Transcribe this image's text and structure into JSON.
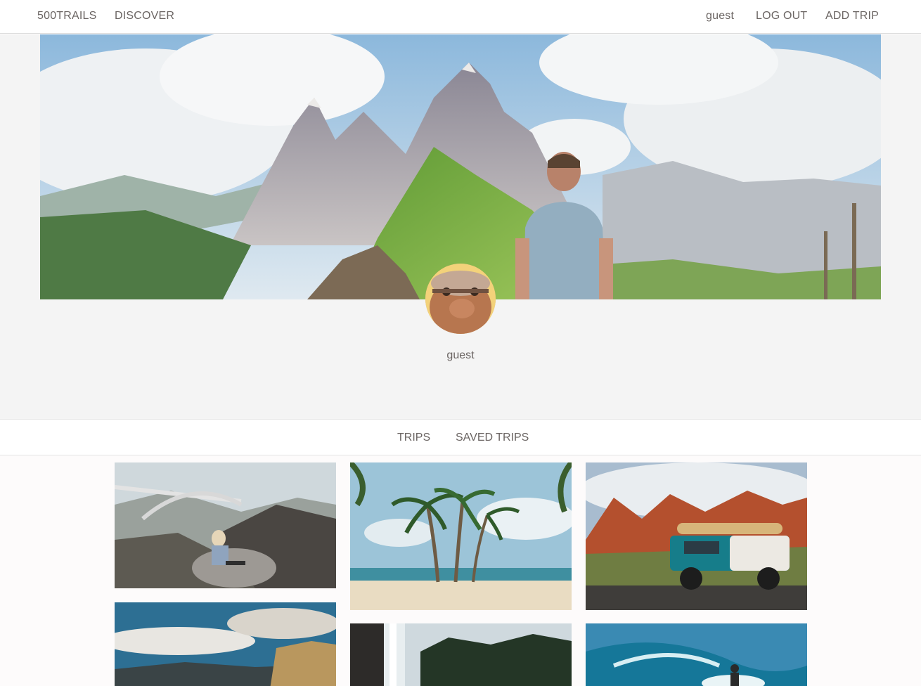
{
  "nav": {
    "brand": "500TRAILS",
    "discover": "DISCOVER",
    "user": "guest",
    "logout": "LOG OUT",
    "add_trip": "ADD TRIP"
  },
  "profile": {
    "username": "guest"
  },
  "tabs": [
    {
      "label": "TRIPS"
    },
    {
      "label": "SAVED TRIPS"
    }
  ],
  "colors": {
    "text": "#6b6563",
    "navbar_bg": "#ffffff",
    "profile_bg": "#f4f4f4",
    "page_bg": "#fdfbfb"
  },
  "trips": [
    {
      "image": "bridge-coast-photo"
    },
    {
      "image": "palm-beach-photo"
    },
    {
      "image": "desert-jeep-photo"
    },
    {
      "image": "cliff-clouds-photo"
    },
    {
      "image": "waterfall-forest-photo"
    },
    {
      "image": "surfer-wave-photo"
    }
  ]
}
